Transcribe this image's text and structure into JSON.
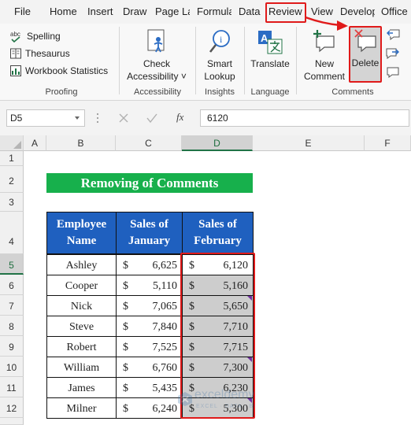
{
  "tabs": [
    "File",
    "Home",
    "Insert",
    "Draw",
    "Page La",
    "Formula",
    "Data",
    "Review",
    "View",
    "Develop",
    "Office"
  ],
  "ribbon": {
    "proofing": {
      "items": [
        "Spelling",
        "Thesaurus",
        "Workbook Statistics"
      ],
      "label": "Proofing"
    },
    "accessibility": {
      "button_line1": "Check",
      "button_line2": "Accessibility ˅",
      "label": "Accessibility"
    },
    "insights": {
      "button_line1": "Smart",
      "button_line2": "Lookup",
      "label": "Insights"
    },
    "language": {
      "button": "Translate",
      "label": "Language"
    },
    "comments": {
      "new_line1": "New",
      "new_line2": "Comment",
      "delete": "Delete",
      "label": "Comments"
    }
  },
  "formula_bar": {
    "name_box": "D5",
    "fx": "fx",
    "value": "6120"
  },
  "grid": {
    "columns": [
      "A",
      "B",
      "C",
      "D",
      "E",
      "F"
    ],
    "rows": [
      "1",
      "2",
      "3",
      "4",
      "5",
      "6",
      "7",
      "8",
      "9",
      "10",
      "11",
      "12"
    ],
    "selected_column": "D",
    "title": "Removing of Comments",
    "headers": [
      "Employee Name",
      "Sales of January",
      "Sales of February"
    ],
    "currency": "$",
    "records": [
      {
        "name": "Ashley",
        "jan": "6,625",
        "feb": "6,120"
      },
      {
        "name": "Cooper",
        "jan": "5,110",
        "feb": "5,160"
      },
      {
        "name": "Nick",
        "jan": "7,065",
        "feb": "5,650"
      },
      {
        "name": "Steve",
        "jan": "7,840",
        "feb": "7,710"
      },
      {
        "name": "Robert",
        "jan": "7,525",
        "feb": "7,715"
      },
      {
        "name": "William",
        "jan": "6,760",
        "feb": "7,300"
      },
      {
        "name": "James",
        "jan": "5,435",
        "feb": "6,230"
      },
      {
        "name": "Milner",
        "jan": "6,240",
        "feb": "5,300"
      }
    ]
  },
  "watermark": {
    "brand": "exceldemy",
    "tagline": "EXCEL · DATA · BI"
  },
  "colors": {
    "title_green": "#17b04c",
    "header_blue": "#1f60bf",
    "highlight_red": "#e01a1a",
    "comment_indicator": "#7030a0"
  }
}
